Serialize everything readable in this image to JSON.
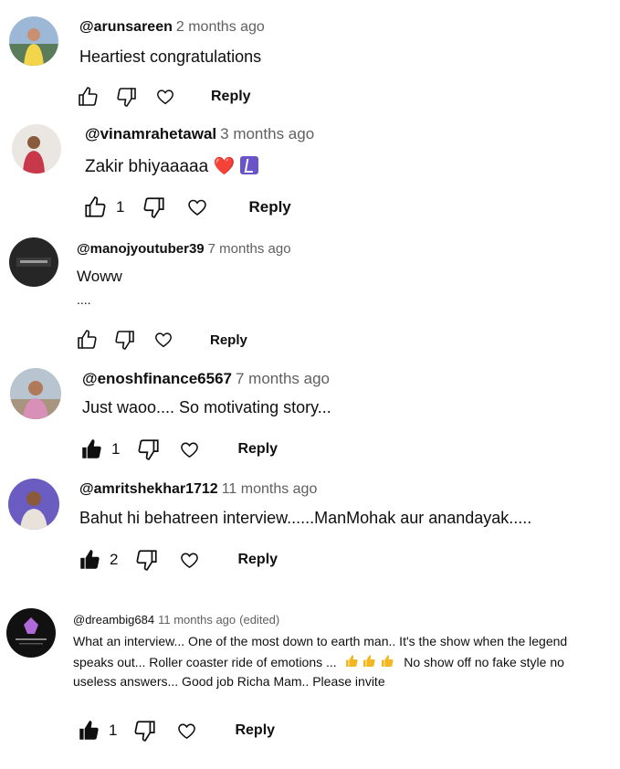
{
  "comments": [
    {
      "author": "@arunsareen",
      "time": "2 months ago",
      "text": "Heartiest congratulations",
      "likes": "",
      "reply": "Reply",
      "liked": false
    },
    {
      "author": "@vinamrahetawal",
      "time": "3 months ago",
      "text": "Zakir bhiyaaaaa",
      "emoji_heart": "❤️",
      "likes": "1",
      "reply": "Reply",
      "liked": false
    },
    {
      "author": "@manojyoutuber39",
      "time": "7 months ago",
      "text": "Woww",
      "text2": "....",
      "likes": "",
      "reply": "Reply",
      "liked": false
    },
    {
      "author": "@enoshfinance6567",
      "time": "7 months ago",
      "text": "Just waoo.... So motivating story...",
      "likes": "1",
      "reply": "Reply",
      "liked": true
    },
    {
      "author": "@amritshekhar1712",
      "time": "11 months ago",
      "text": "Bahut hi behatreen interview......ManMohak aur anandayak.....",
      "likes": "2",
      "reply": "Reply",
      "liked": true
    },
    {
      "author": "@dreambig684",
      "time": "11 months ago",
      "edited": "(edited)",
      "line1": "What an interview... One of the most down to earth man.. It's the show when the legend",
      "line2a": "speaks out... Roller coaster ride of emotions ...",
      "line2b": "No show off no fake style no",
      "line3": "useless answers... Good job Richa Mam.. Please invite",
      "likes": "1",
      "reply": "Reply",
      "liked": true
    }
  ],
  "icons": {
    "like": "thumbs-up-icon",
    "dislike": "thumbs-down-icon",
    "heart": "heart-icon"
  }
}
